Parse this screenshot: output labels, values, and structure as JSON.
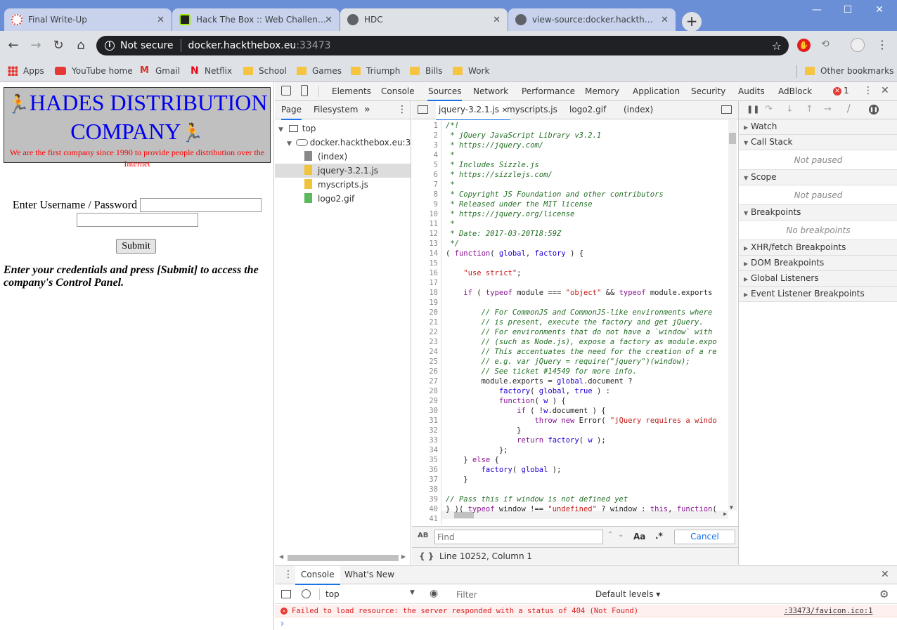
{
  "browser": {
    "tabs": [
      {
        "title": "Final Write-Up",
        "active": false
      },
      {
        "title": "Hack The Box :: Web Challenges",
        "active": false
      },
      {
        "title": "HDC",
        "active": true
      },
      {
        "title": "view-source:docker.hackthebox.e",
        "active": false
      }
    ],
    "window_buttons": {
      "minimize": "—",
      "maximize": "☐",
      "close": "✕"
    },
    "omnibox": {
      "security_label": "Not secure",
      "host": "docker.hackthebox.eu",
      "port": ":33473"
    },
    "bookmarks": [
      "Apps",
      "YouTube home",
      "Gmail",
      "Netflix",
      "School",
      "Games",
      "Triumph",
      "Bills",
      "Work"
    ],
    "other_bookmarks": "Other bookmarks"
  },
  "page": {
    "title_line1": "HADES DISTRIBUTION",
    "title_line2": "COMPANY",
    "subtitle": "We are the first company since 1990 to provide people distribution over the Internet",
    "login_label": "Enter Username / Password",
    "submit_label": "Submit",
    "instructions": "Enter your credentials and press [Submit] to access the company's Control Panel."
  },
  "devtools": {
    "main_tabs": [
      "Elements",
      "Console",
      "Sources",
      "Network",
      "Performance",
      "Memory",
      "Application",
      "Security",
      "Audits",
      "AdBlock"
    ],
    "active_tab": "Sources",
    "error_count": "1",
    "navigator": {
      "tabs": [
        "Page",
        "Filesystem"
      ],
      "tree": [
        {
          "label": "top",
          "level": 0,
          "kind": "frame"
        },
        {
          "label": "docker.hackthebox.eu:33473",
          "level": 1,
          "kind": "origin"
        },
        {
          "label": "(index)",
          "level": 2,
          "kind": "doc"
        },
        {
          "label": "jquery-3.2.1.js",
          "level": 2,
          "kind": "js",
          "selected": true
        },
        {
          "label": "myscripts.js",
          "level": 2,
          "kind": "js"
        },
        {
          "label": "logo2.gif",
          "level": 2,
          "kind": "img"
        }
      ]
    },
    "editor_tabs": [
      "jquery-3.2.1.js",
      "myscripts.js",
      "logo2.gif",
      "(index)"
    ],
    "code_lines": [
      "/*!",
      " * jQuery JavaScript Library v3.2.1",
      " * https://jquery.com/",
      " *",
      " * Includes Sizzle.js",
      " * https://sizzlejs.com/",
      " *",
      " * Copyright JS Foundation and other contributors",
      " * Released under the MIT license",
      " * https://jquery.org/license",
      " *",
      " * Date: 2017-03-20T18:59Z",
      " */",
      "( function( global, factory ) {",
      "",
      "    \"use strict\";",
      "",
      "    if ( typeof module === \"object\" && typeof module.exports",
      "",
      "        // For CommonJS and CommonJS-like environments where",
      "        // is present, execute the factory and get jQuery.",
      "        // For environments that do not have a `window` with",
      "        // (such as Node.js), expose a factory as module.expo",
      "        // This accentuates the need for the creation of a re",
      "        // e.g. var jQuery = require(\"jquery\")(window);",
      "        // See ticket #14549 for more info.",
      "        module.exports = global.document ?",
      "            factory( global, true ) :",
      "            function( w ) {",
      "                if ( !w.document ) {",
      "                    throw new Error( \"jQuery requires a windo",
      "                }",
      "                return factory( w );",
      "            };",
      "    } else {",
      "        factory( global );",
      "    }",
      "",
      "// Pass this if window is not defined yet",
      "} )( typeof window !== \"undefined\" ? window : this, function(",
      ""
    ],
    "find_placeholder": "Find",
    "find_case": "Aa",
    "find_regex": ".*",
    "find_cancel": "Cancel",
    "cursor_status": "Line 10252, Column 1",
    "sidebar_sections": [
      {
        "label": "Watch"
      },
      {
        "label": "Call Stack",
        "note": "Not paused"
      },
      {
        "label": "Scope",
        "note": "Not paused"
      },
      {
        "label": "Breakpoints",
        "note": "No breakpoints"
      },
      {
        "label": "XHR/fetch Breakpoints"
      },
      {
        "label": "DOM Breakpoints"
      },
      {
        "label": "Global Listeners"
      },
      {
        "label": "Event Listener Breakpoints"
      }
    ],
    "drawer": {
      "tabs": [
        "Console",
        "What's New"
      ],
      "context": "top",
      "filter_placeholder": "Filter",
      "levels": "Default levels ▾",
      "error_message": "Failed to load resource: the server responded with a status of 404 (Not Found)",
      "error_source": ":33473/favicon.ico:1",
      "prompt": "›"
    }
  }
}
